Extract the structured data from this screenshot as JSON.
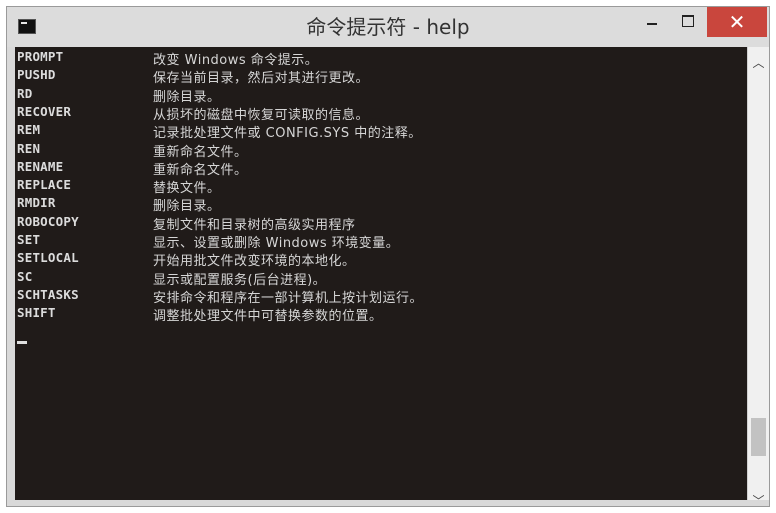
{
  "window": {
    "title": "命令提示符 - help",
    "controls": {
      "minimize_label": "",
      "maximize_label": "",
      "close_label": "✕"
    }
  },
  "console": {
    "entries": [
      {
        "cmd": "PROMPT",
        "desc": "改变 Windows 命令提示。"
      },
      {
        "cmd": "PUSHD",
        "desc": "保存当前目录，然后对其进行更改。"
      },
      {
        "cmd": "RD",
        "desc": "删除目录。"
      },
      {
        "cmd": "RECOVER",
        "desc": "从损坏的磁盘中恢复可读取的信息。"
      },
      {
        "cmd": "REM",
        "desc": "记录批处理文件或 CONFIG.SYS 中的注释。"
      },
      {
        "cmd": "REN",
        "desc": "重新命名文件。"
      },
      {
        "cmd": "RENAME",
        "desc": "重新命名文件。"
      },
      {
        "cmd": "REPLACE",
        "desc": "替换文件。"
      },
      {
        "cmd": "RMDIR",
        "desc": "删除目录。"
      },
      {
        "cmd": "ROBOCOPY",
        "desc": "复制文件和目录树的高级实用程序"
      },
      {
        "cmd": "SET",
        "desc": "显示、设置或删除 Windows 环境变量。"
      },
      {
        "cmd": "SETLOCAL",
        "desc": "开始用批文件改变环境的本地化。"
      },
      {
        "cmd": "SC",
        "desc": "显示或配置服务(后台进程)。"
      },
      {
        "cmd": "SCHTASKS",
        "desc": "安排命令和程序在一部计算机上按计划运行。"
      },
      {
        "cmd": "SHIFT",
        "desc": "调整批处理文件中可替换参数的位置。"
      }
    ]
  },
  "scrollbar": {
    "up_icon": "chevron-up-icon",
    "down_icon": "chevron-down-icon",
    "up_glyph": "︿",
    "down_glyph": "﹀",
    "position_fraction": 0.88
  },
  "colors": {
    "console_bg": "#201b19",
    "console_text": "#d6d6d6",
    "close_button": "#c9463d",
    "titlebar": "#dcdcdc"
  }
}
